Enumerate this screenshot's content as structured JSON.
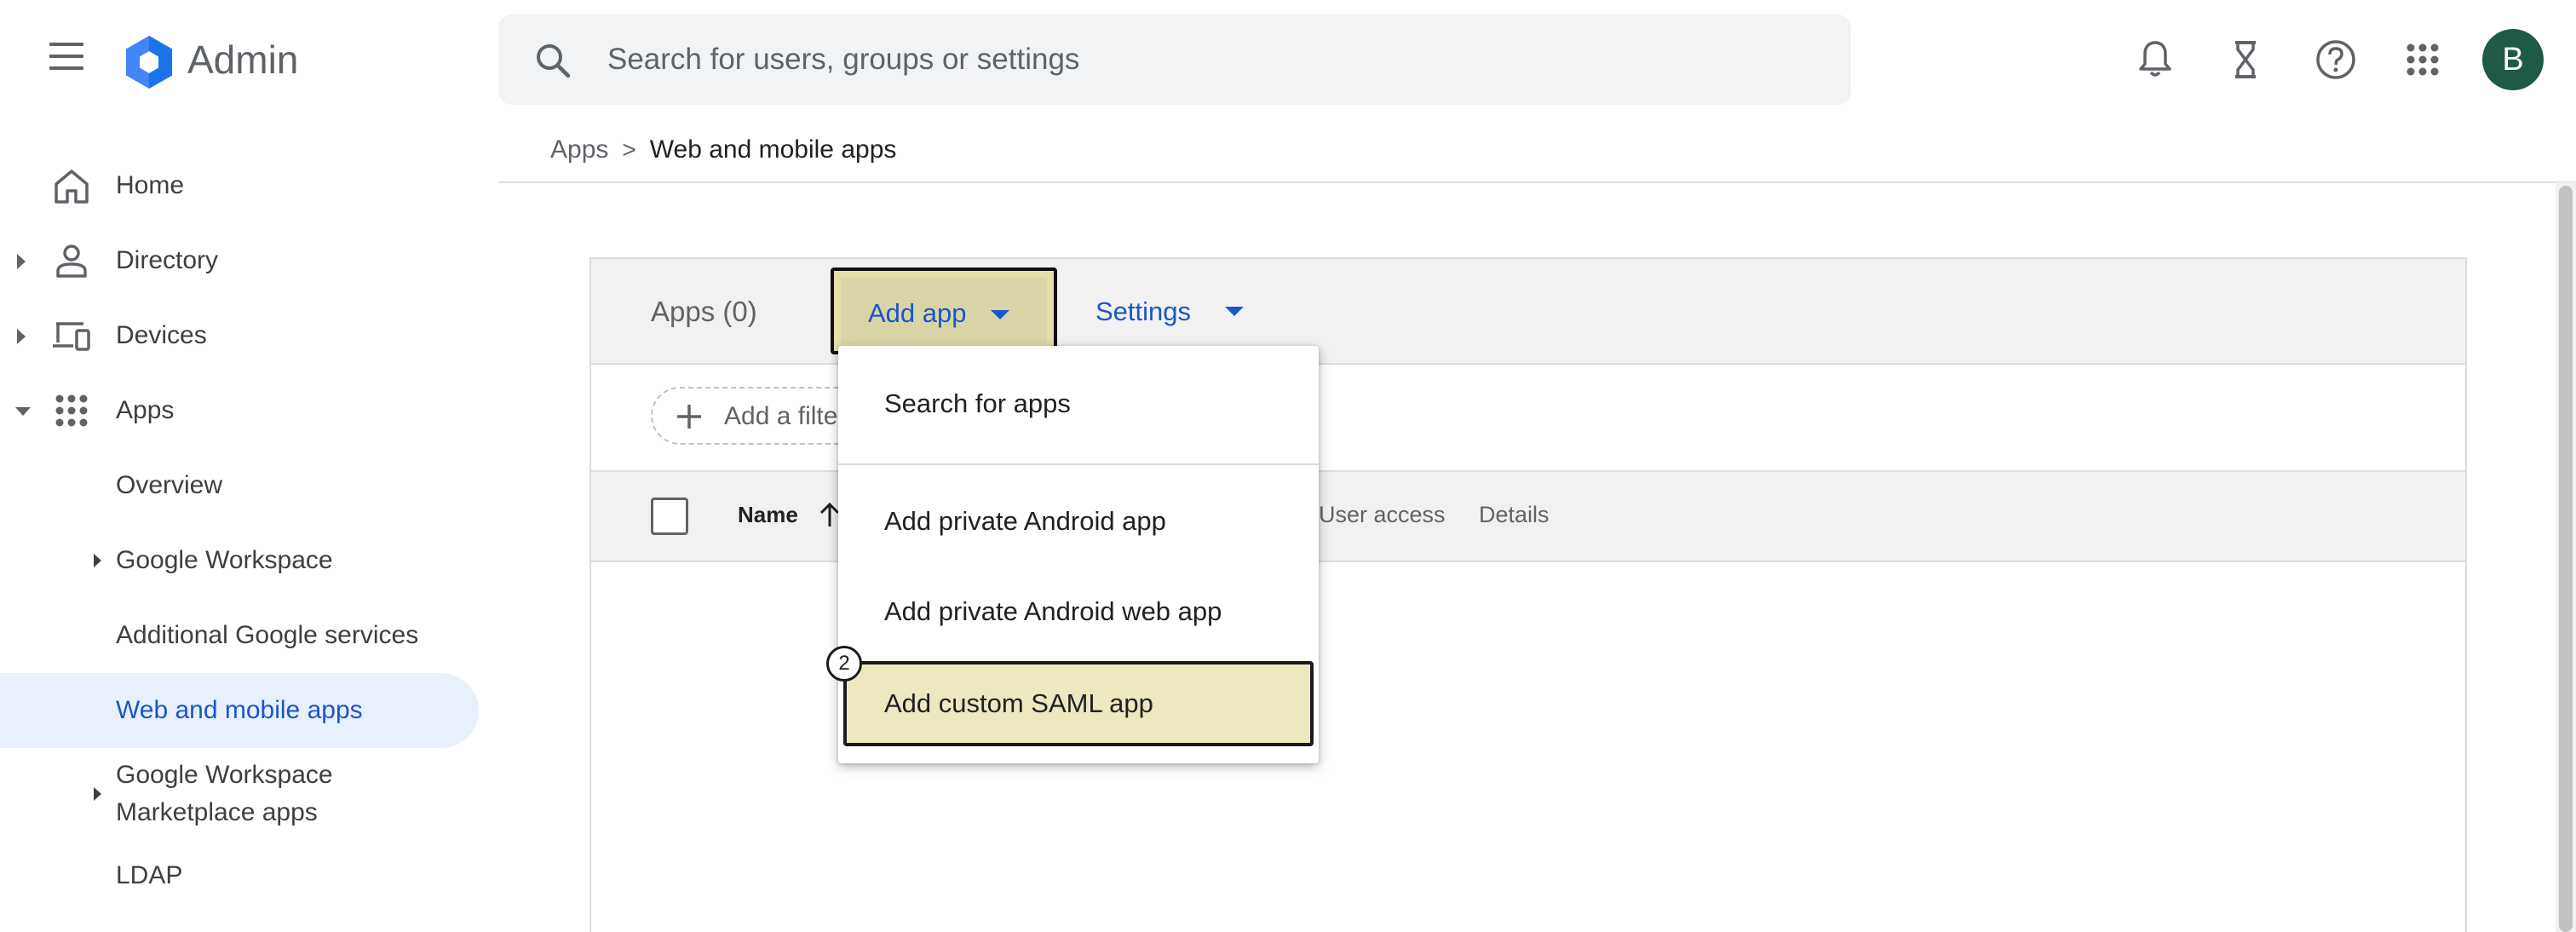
{
  "header": {
    "brand": "Admin",
    "search_placeholder": "Search for users, groups or settings",
    "avatar_initial": "B"
  },
  "sidebar": {
    "items": [
      {
        "label": "Home",
        "icon": "home-icon"
      },
      {
        "label": "Directory",
        "icon": "person-icon"
      },
      {
        "label": "Devices",
        "icon": "devices-icon"
      },
      {
        "label": "Apps",
        "icon": "apps-grid-icon"
      }
    ],
    "apps_children": [
      {
        "label": "Overview"
      },
      {
        "label": "Google Workspace"
      },
      {
        "label": "Additional Google services"
      },
      {
        "label": "Web and mobile apps"
      },
      {
        "label": "Google Workspace\nMarketplace apps"
      },
      {
        "label": "LDAP"
      }
    ]
  },
  "breadcrumb": {
    "parent": "Apps",
    "separator": ">",
    "current": "Web and mobile apps"
  },
  "card": {
    "title": "Apps (0)",
    "add_app_label": "Add app",
    "settings_label": "Settings",
    "filter_placeholder": "Add a filter",
    "columns": {
      "name": "Name",
      "user_access": "User access",
      "details": "Details"
    }
  },
  "dropdown": {
    "items": [
      "Search for apps",
      "Add private Android app",
      "Add private Android web app",
      "Add custom SAML app"
    ],
    "step_badge": "2"
  },
  "colors": {
    "accent": "#1a56c8",
    "active_nav_bg": "#e8f0fe",
    "highlight": "#ede8bd",
    "avatar_bg": "#1e5a45"
  }
}
